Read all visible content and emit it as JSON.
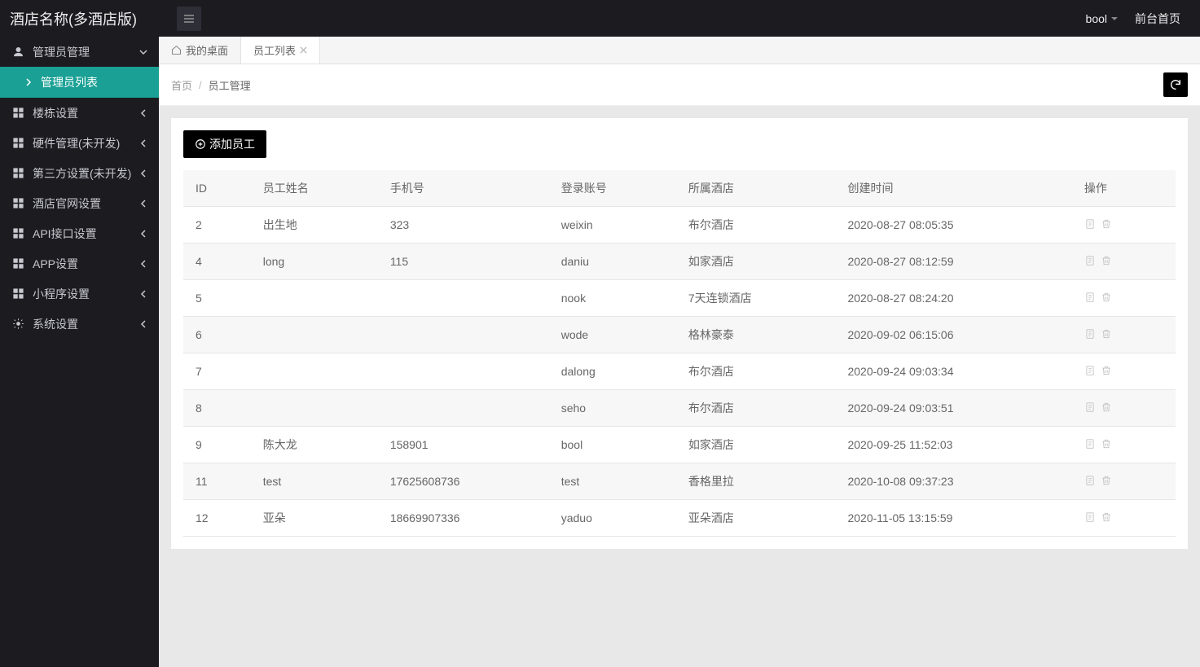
{
  "header": {
    "brand": "酒店名称(多酒店版)",
    "user": "bool",
    "front_link": "前台首页"
  },
  "sidebar": {
    "items": [
      {
        "label": "管理员管理",
        "icon": "user",
        "expanded": true
      },
      {
        "label": "楼栋设置",
        "icon": "grid",
        "expanded": false
      },
      {
        "label": "硬件管理(未开发)",
        "icon": "grid",
        "expanded": false
      },
      {
        "label": "第三方设置(未开发)",
        "icon": "grid",
        "expanded": false
      },
      {
        "label": "酒店官网设置",
        "icon": "grid",
        "expanded": false
      },
      {
        "label": "API接口设置",
        "icon": "grid",
        "expanded": false
      },
      {
        "label": "APP设置",
        "icon": "grid",
        "expanded": false
      },
      {
        "label": "小程序设置",
        "icon": "grid",
        "expanded": false
      },
      {
        "label": "系统设置",
        "icon": "gear",
        "expanded": false
      }
    ],
    "sub_active": "管理员列表"
  },
  "tabs": [
    {
      "label": "我的桌面",
      "home": true,
      "closable": false,
      "active": false
    },
    {
      "label": "员工列表",
      "home": false,
      "closable": true,
      "active": true
    }
  ],
  "breadcrumb": {
    "root": "首页",
    "current": "员工管理"
  },
  "add_button": "添加员工",
  "table": {
    "columns": [
      "ID",
      "员工姓名",
      "手机号",
      "登录账号",
      "所属酒店",
      "创建时间",
      "操作"
    ],
    "rows": [
      {
        "id": "2",
        "name": "出生地",
        "phone": "323",
        "account": "weixin",
        "hotel": "布尔酒店",
        "created": "2020-08-27 08:05:35"
      },
      {
        "id": "4",
        "name": "long",
        "phone": "115",
        "account": "daniu",
        "hotel": "如家酒店",
        "created": "2020-08-27 08:12:59"
      },
      {
        "id": "5",
        "name": "",
        "phone": "",
        "account": "nook",
        "hotel": "7天连锁酒店",
        "created": "2020-08-27 08:24:20"
      },
      {
        "id": "6",
        "name": "",
        "phone": "",
        "account": "wode",
        "hotel": "格林豪泰",
        "created": "2020-09-02 06:15:06"
      },
      {
        "id": "7",
        "name": "",
        "phone": "",
        "account": "dalong",
        "hotel": "布尔酒店",
        "created": "2020-09-24 09:03:34"
      },
      {
        "id": "8",
        "name": "",
        "phone": "",
        "account": "seho",
        "hotel": "布尔酒店",
        "created": "2020-09-24 09:03:51"
      },
      {
        "id": "9",
        "name": "陈大龙",
        "phone": "158901",
        "account": "bool",
        "hotel": "如家酒店",
        "created": "2020-09-25 11:52:03"
      },
      {
        "id": "11",
        "name": "test",
        "phone": "17625608736",
        "account": "test",
        "hotel": "香格里拉",
        "created": "2020-10-08 09:37:23"
      },
      {
        "id": "12",
        "name": "亚朵",
        "phone": "18669907336",
        "account": "yaduo",
        "hotel": "亚朵酒店",
        "created": "2020-11-05 13:15:59"
      }
    ]
  }
}
